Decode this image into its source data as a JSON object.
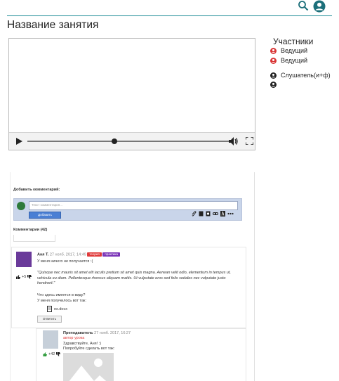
{
  "header": {
    "search_icon": "search-icon",
    "user_icon": "user-circle-icon",
    "accent": "#1c8a96"
  },
  "lesson": {
    "title": "Название занятия"
  },
  "participants": {
    "title": "Участники",
    "items": [
      {
        "label": "Ведущий",
        "color": "#d93535"
      },
      {
        "label": "Ведущий",
        "color": "#d93535"
      },
      {
        "label": "Слушатель(и+ф)",
        "color": "#222222"
      },
      {
        "label": "",
        "color": "#222222"
      }
    ]
  },
  "player": {
    "progress": 0.43
  },
  "comments": {
    "add_title": "Добавить комментарий:",
    "input_placeholder": "Текст комментария...",
    "submit_label": "Добавить",
    "count_label": "Комментарии (42)",
    "items": [
      {
        "author": "Аня Т.",
        "date": "27 нояб. 2017, 14:49",
        "tags": [
          {
            "label": "теория",
            "color": "#e03a3a"
          },
          {
            "label": "практика",
            "color": "#7a34b8"
          }
        ],
        "text": "У меня ничего не получается :(",
        "quote": "\"Quisque nec mauris sit amet elit iaculis pretium sit amet quis magna. Aenean velit odio, elementum in tempus ut, vehicula eu diam. Pellentesque rhoncus aliquam mattis. Ut vulputate eros sed felis sodales nec vulputate justo hendrerit.\"",
        "question": "Что здесь имеется в виду?",
        "followup": "У меня получилось вот так:",
        "file": "ex.docx",
        "votes": "+5",
        "reply_label": "Ответить"
      },
      {
        "author": "Преподаватель",
        "date": "27 нояб. 2017, 16:27",
        "role": "автор урока",
        "text": "Здравствуйте, Аня! :)",
        "text2": "Попробуйте сделать вот так:",
        "votes": "+42"
      }
    ]
  }
}
